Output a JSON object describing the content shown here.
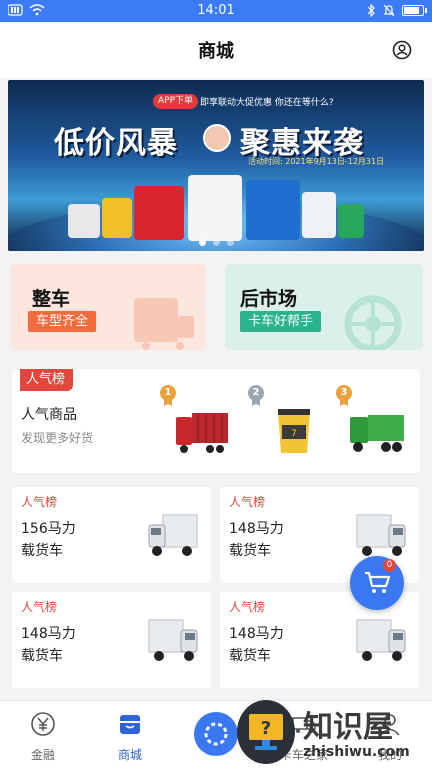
{
  "status_bar": {
    "time": "14:01"
  },
  "header": {
    "title": "商城"
  },
  "banner": {
    "pill": "APP下单",
    "subline": "即享联动大促优惠 你还在等什么?",
    "headline_a": "低价风暴",
    "headline_b": "聚惠来袭",
    "dates": "活动时间: 2021年9月13日-12月31日",
    "slides": 3,
    "active_slide": 1
  },
  "categories": [
    {
      "title": "整车",
      "tag": "车型齐全"
    },
    {
      "title": "后市场",
      "tag": "卡车好帮手"
    }
  ],
  "popular": {
    "ribbon": "人气榜",
    "title": "人气商品",
    "subtitle": "发现更多好货",
    "medals": [
      "1",
      "2",
      "3"
    ]
  },
  "cards": [
    {
      "tag": "人气榜",
      "line1": "156马力",
      "line2": "载货车"
    },
    {
      "tag": "人气榜",
      "line1": "148马力",
      "line2": "载货车"
    },
    {
      "tag": "人气榜",
      "line1": "148马力",
      "line2": "载货车"
    },
    {
      "tag": "人气榜",
      "line1": "148马力",
      "line2": "载货车"
    }
  ],
  "cart": {
    "count": "0"
  },
  "tabs": [
    {
      "label": "金融",
      "icon": "yuan-icon"
    },
    {
      "label": "商城",
      "icon": "store-icon"
    },
    {
      "label": "卡车之家",
      "icon": "truck-icon"
    },
    {
      "label": "我的",
      "icon": "user-icon"
    }
  ],
  "watermark": {
    "brand": "知识屋",
    "url": "zhishiwu.com"
  },
  "colors": {
    "primary": "#3a78f2",
    "accent": "#e2473d",
    "orange": "#f06c3c",
    "green": "#2ab38c"
  }
}
